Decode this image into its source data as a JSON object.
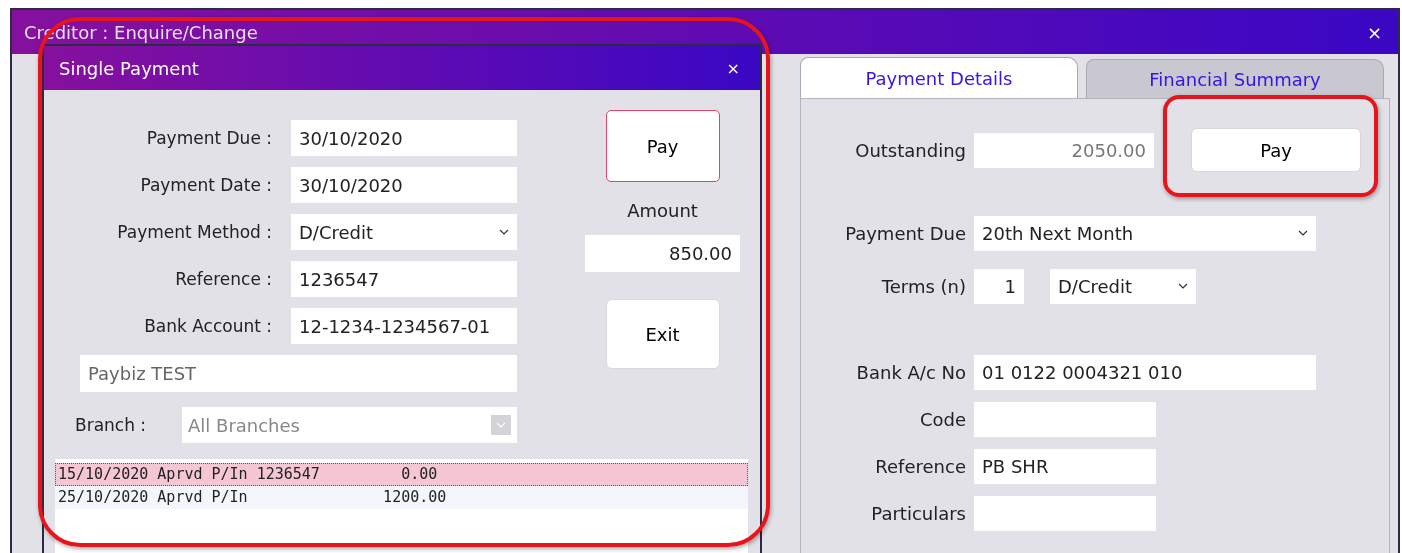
{
  "window": {
    "title": "Creditor : Enquire/Change"
  },
  "tabs": [
    {
      "label": "Payment Details",
      "selected": true
    },
    {
      "label": "Financial Summary",
      "selected": false
    }
  ],
  "payment_details": {
    "outstanding": {
      "label": "Outstanding",
      "value": "2050.00",
      "read_only": true
    },
    "pay_button": "Pay",
    "payment_due": {
      "label": "Payment Due",
      "value": "20th Next Month"
    },
    "terms": {
      "label": "Terms (n)",
      "value": "1",
      "method": "D/Credit"
    },
    "fields": [
      {
        "label": "Bank A/c No",
        "value": "01 0122 0004321 010",
        "wide": true
      },
      {
        "label": "Code",
        "wide": false
      },
      {
        "label": "Reference",
        "value": "PB SHR",
        "wide": false
      },
      {
        "label": "Particulars",
        "wide": false
      }
    ]
  },
  "dialog": {
    "title": "Single Payment",
    "close": "×",
    "fields": [
      {
        "label": "Payment Due :",
        "value": "30/10/2020",
        "kind": "text"
      },
      {
        "label": "Payment Date :",
        "value": "30/10/2020",
        "kind": "text"
      },
      {
        "label": "Payment Method :",
        "value": "D/Credit",
        "kind": "select"
      },
      {
        "label": "Reference :",
        "value": "1236547",
        "kind": "text"
      },
      {
        "label": "Bank Account :",
        "value": "12-1234-1234567-01",
        "kind": "text"
      }
    ],
    "name": "Paybiz TEST",
    "branch": {
      "label": "Branch :",
      "value": "All Branches",
      "disabled": true
    },
    "pay_button": "Pay",
    "amount_label": "Amount",
    "amount": "850.00",
    "exit_button": "Exit",
    "list": [
      {
        "text": "15/10/2020 Aprvd P/In 1236547         0.00",
        "selected": true
      },
      {
        "text": "25/10/2020 Aprvd P/In               1200.00",
        "selected": false
      }
    ]
  }
}
